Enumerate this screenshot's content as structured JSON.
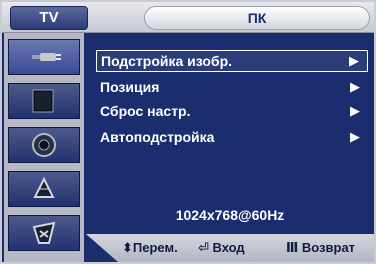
{
  "header": {
    "tv_tab_label": "TV",
    "pc_tab_label": "ПК"
  },
  "sidebar": {
    "items": [
      {
        "icon": "plug-icon"
      },
      {
        "icon": "picture-icon"
      },
      {
        "icon": "sound-icon"
      },
      {
        "icon": "channel-icon"
      },
      {
        "icon": "setup-icon"
      }
    ],
    "active_index": 0
  },
  "menu": {
    "items": [
      {
        "label": "Подстройка изобр.",
        "arrow": "▶",
        "selected": true
      },
      {
        "label": "Позиция",
        "arrow": "▶",
        "selected": false
      },
      {
        "label": "Сброс настр.",
        "arrow": "▶",
        "selected": false
      },
      {
        "label": "Автоподстройка",
        "arrow": "▶",
        "selected": false
      }
    ]
  },
  "status": {
    "resolution": "1024x768@60Hz"
  },
  "footer": {
    "move_hint": "⬍Перем.",
    "enter_hint": "⏎ Вход",
    "return_hint": "Ⅲ Возврат"
  },
  "colors": {
    "background": "#1a2d6e",
    "panel": "#c9ccd6",
    "text": "#ffffff"
  }
}
